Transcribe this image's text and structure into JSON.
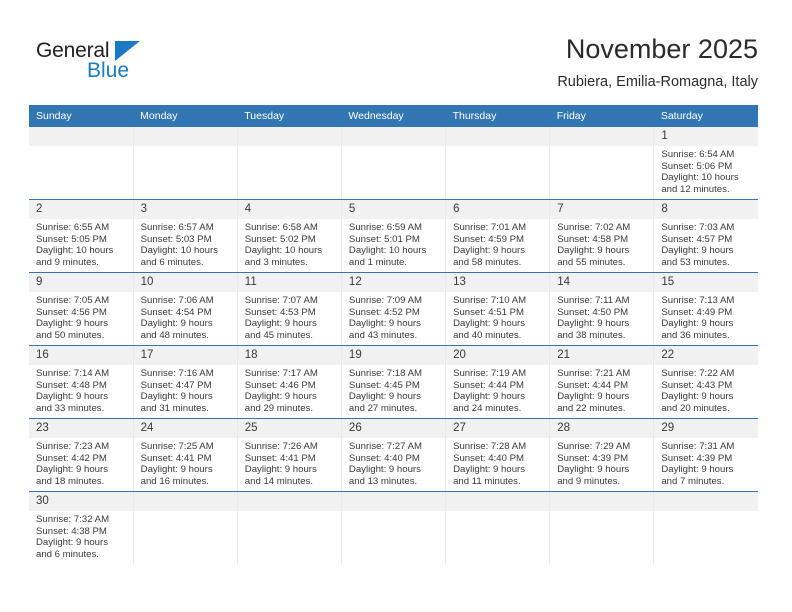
{
  "brand": {
    "name_part1": "General",
    "name_part2": "Blue",
    "triangle_icon": "triangle-icon",
    "colors": {
      "blue": "#1a7ac4",
      "dark": "#231f20"
    }
  },
  "header": {
    "title": "November 2025",
    "subtitle": "Rubiera, Emilia-Romagna, Italy"
  },
  "theme": {
    "header_blue": "#3176b2",
    "daynum_gray": "#f1f1f1",
    "text": "#3a3a3a"
  },
  "weekday_headers": [
    "Sunday",
    "Monday",
    "Tuesday",
    "Wednesday",
    "Thursday",
    "Friday",
    "Saturday"
  ],
  "weeks": [
    [
      {
        "day": "",
        "empty": true
      },
      {
        "day": "",
        "empty": true
      },
      {
        "day": "",
        "empty": true
      },
      {
        "day": "",
        "empty": true
      },
      {
        "day": "",
        "empty": true
      },
      {
        "day": "",
        "empty": true
      },
      {
        "day": "1",
        "sunrise": "Sunrise: 6:54 AM",
        "sunset": "Sunset: 5:06 PM",
        "daylight_line1": "Daylight: 10 hours",
        "daylight_line2": "and 12 minutes."
      }
    ],
    [
      {
        "day": "2",
        "sunrise": "Sunrise: 6:55 AM",
        "sunset": "Sunset: 5:05 PM",
        "daylight_line1": "Daylight: 10 hours",
        "daylight_line2": "and 9 minutes."
      },
      {
        "day": "3",
        "sunrise": "Sunrise: 6:57 AM",
        "sunset": "Sunset: 5:03 PM",
        "daylight_line1": "Daylight: 10 hours",
        "daylight_line2": "and 6 minutes."
      },
      {
        "day": "4",
        "sunrise": "Sunrise: 6:58 AM",
        "sunset": "Sunset: 5:02 PM",
        "daylight_line1": "Daylight: 10 hours",
        "daylight_line2": "and 3 minutes."
      },
      {
        "day": "5",
        "sunrise": "Sunrise: 6:59 AM",
        "sunset": "Sunset: 5:01 PM",
        "daylight_line1": "Daylight: 10 hours",
        "daylight_line2": "and 1 minute."
      },
      {
        "day": "6",
        "sunrise": "Sunrise: 7:01 AM",
        "sunset": "Sunset: 4:59 PM",
        "daylight_line1": "Daylight: 9 hours",
        "daylight_line2": "and 58 minutes."
      },
      {
        "day": "7",
        "sunrise": "Sunrise: 7:02 AM",
        "sunset": "Sunset: 4:58 PM",
        "daylight_line1": "Daylight: 9 hours",
        "daylight_line2": "and 55 minutes."
      },
      {
        "day": "8",
        "sunrise": "Sunrise: 7:03 AM",
        "sunset": "Sunset: 4:57 PM",
        "daylight_line1": "Daylight: 9 hours",
        "daylight_line2": "and 53 minutes."
      }
    ],
    [
      {
        "day": "9",
        "sunrise": "Sunrise: 7:05 AM",
        "sunset": "Sunset: 4:56 PM",
        "daylight_line1": "Daylight: 9 hours",
        "daylight_line2": "and 50 minutes."
      },
      {
        "day": "10",
        "sunrise": "Sunrise: 7:06 AM",
        "sunset": "Sunset: 4:54 PM",
        "daylight_line1": "Daylight: 9 hours",
        "daylight_line2": "and 48 minutes."
      },
      {
        "day": "11",
        "sunrise": "Sunrise: 7:07 AM",
        "sunset": "Sunset: 4:53 PM",
        "daylight_line1": "Daylight: 9 hours",
        "daylight_line2": "and 45 minutes."
      },
      {
        "day": "12",
        "sunrise": "Sunrise: 7:09 AM",
        "sunset": "Sunset: 4:52 PM",
        "daylight_line1": "Daylight: 9 hours",
        "daylight_line2": "and 43 minutes."
      },
      {
        "day": "13",
        "sunrise": "Sunrise: 7:10 AM",
        "sunset": "Sunset: 4:51 PM",
        "daylight_line1": "Daylight: 9 hours",
        "daylight_line2": "and 40 minutes."
      },
      {
        "day": "14",
        "sunrise": "Sunrise: 7:11 AM",
        "sunset": "Sunset: 4:50 PM",
        "daylight_line1": "Daylight: 9 hours",
        "daylight_line2": "and 38 minutes."
      },
      {
        "day": "15",
        "sunrise": "Sunrise: 7:13 AM",
        "sunset": "Sunset: 4:49 PM",
        "daylight_line1": "Daylight: 9 hours",
        "daylight_line2": "and 36 minutes."
      }
    ],
    [
      {
        "day": "16",
        "sunrise": "Sunrise: 7:14 AM",
        "sunset": "Sunset: 4:48 PM",
        "daylight_line1": "Daylight: 9 hours",
        "daylight_line2": "and 33 minutes."
      },
      {
        "day": "17",
        "sunrise": "Sunrise: 7:16 AM",
        "sunset": "Sunset: 4:47 PM",
        "daylight_line1": "Daylight: 9 hours",
        "daylight_line2": "and 31 minutes."
      },
      {
        "day": "18",
        "sunrise": "Sunrise: 7:17 AM",
        "sunset": "Sunset: 4:46 PM",
        "daylight_line1": "Daylight: 9 hours",
        "daylight_line2": "and 29 minutes."
      },
      {
        "day": "19",
        "sunrise": "Sunrise: 7:18 AM",
        "sunset": "Sunset: 4:45 PM",
        "daylight_line1": "Daylight: 9 hours",
        "daylight_line2": "and 27 minutes."
      },
      {
        "day": "20",
        "sunrise": "Sunrise: 7:19 AM",
        "sunset": "Sunset: 4:44 PM",
        "daylight_line1": "Daylight: 9 hours",
        "daylight_line2": "and 24 minutes."
      },
      {
        "day": "21",
        "sunrise": "Sunrise: 7:21 AM",
        "sunset": "Sunset: 4:44 PM",
        "daylight_line1": "Daylight: 9 hours",
        "daylight_line2": "and 22 minutes."
      },
      {
        "day": "22",
        "sunrise": "Sunrise: 7:22 AM",
        "sunset": "Sunset: 4:43 PM",
        "daylight_line1": "Daylight: 9 hours",
        "daylight_line2": "and 20 minutes."
      }
    ],
    [
      {
        "day": "23",
        "sunrise": "Sunrise: 7:23 AM",
        "sunset": "Sunset: 4:42 PM",
        "daylight_line1": "Daylight: 9 hours",
        "daylight_line2": "and 18 minutes."
      },
      {
        "day": "24",
        "sunrise": "Sunrise: 7:25 AM",
        "sunset": "Sunset: 4:41 PM",
        "daylight_line1": "Daylight: 9 hours",
        "daylight_line2": "and 16 minutes."
      },
      {
        "day": "25",
        "sunrise": "Sunrise: 7:26 AM",
        "sunset": "Sunset: 4:41 PM",
        "daylight_line1": "Daylight: 9 hours",
        "daylight_line2": "and 14 minutes."
      },
      {
        "day": "26",
        "sunrise": "Sunrise: 7:27 AM",
        "sunset": "Sunset: 4:40 PM",
        "daylight_line1": "Daylight: 9 hours",
        "daylight_line2": "and 13 minutes."
      },
      {
        "day": "27",
        "sunrise": "Sunrise: 7:28 AM",
        "sunset": "Sunset: 4:40 PM",
        "daylight_line1": "Daylight: 9 hours",
        "daylight_line2": "and 11 minutes."
      },
      {
        "day": "28",
        "sunrise": "Sunrise: 7:29 AM",
        "sunset": "Sunset: 4:39 PM",
        "daylight_line1": "Daylight: 9 hours",
        "daylight_line2": "and 9 minutes."
      },
      {
        "day": "29",
        "sunrise": "Sunrise: 7:31 AM",
        "sunset": "Sunset: 4:39 PM",
        "daylight_line1": "Daylight: 9 hours",
        "daylight_line2": "and 7 minutes."
      }
    ],
    [
      {
        "day": "30",
        "sunrise": "Sunrise: 7:32 AM",
        "sunset": "Sunset: 4:38 PM",
        "daylight_line1": "Daylight: 9 hours",
        "daylight_line2": "and 6 minutes."
      },
      {
        "day": "",
        "empty": true
      },
      {
        "day": "",
        "empty": true
      },
      {
        "day": "",
        "empty": true
      },
      {
        "day": "",
        "empty": true
      },
      {
        "day": "",
        "empty": true
      },
      {
        "day": "",
        "empty": true
      }
    ]
  ]
}
